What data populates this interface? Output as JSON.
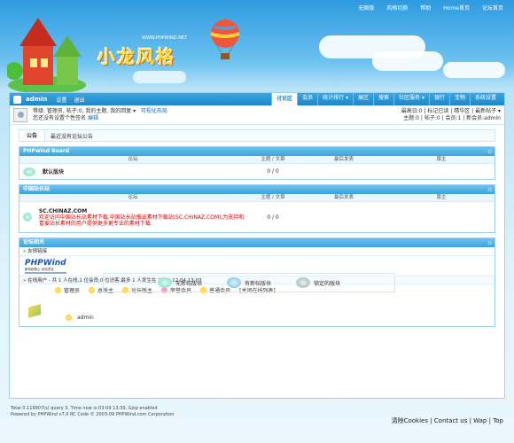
{
  "topnav": [
    "无图版",
    "风格切换",
    "帮助",
    "Home首页",
    "论坛首页"
  ],
  "logo": {
    "text": "小龙风格",
    "url": "WWW.PHPWIND.NET"
  },
  "userbar": {
    "username": "admin",
    "links": [
      "设置",
      "退出"
    ],
    "menu": [
      "讨论区",
      "会员",
      "统计排行 ▾",
      "展区",
      "搜索",
      "社区服务 ▾",
      "银行",
      "宝物",
      "系统设置"
    ]
  },
  "info": {
    "line1": "等级: 管理员, 帖子:0, 我的主题, 我的回复 ▾",
    "line1b": "可视化布局",
    "line2": "您还没有设置个性签名",
    "line2b": "编辑",
    "right1": "最高日:0 | 标记已读 | 精华区 | 最新帖子 ▾",
    "right2": "主题:0 | 帖子:0 | 会员:1 | 新会员:admin"
  },
  "notice": {
    "label": "公告",
    "text": "最近没有论坛公告"
  },
  "columns": {
    "forum": "论坛",
    "topics": "主题 / 文章",
    "lastpost": "最后发表",
    "moderator": "版主"
  },
  "sections": [
    {
      "title": "PHPwind Board",
      "forum_name": "默认版块",
      "counts": "0 / 0"
    },
    {
      "title": "中国站长站",
      "counts": "0 / 0",
      "chinaz_title": "SC.CHINAZ.COM",
      "chinaz_text": "欢迎访问中国站长站素材下载,中国站长站推出素材下载站(SC.CHINAZ.COM),为支持和喜爱站长素材的用户提供更多更专业的素材下载."
    }
  ],
  "stats": {
    "title": "论坛相关",
    "links_label": "友情链接",
    "pw_logo": "PHPWind",
    "pw_sub": "新世纪网上 论坛发言",
    "online": "在线用户 - 共 1 人在线,1 位会员,0 位访客,最多 1 人发生在 2008-12-04 13:03",
    "legend": [
      "管理员",
      "总版主",
      "论坛版主",
      "荣誉会员",
      "普通会员",
      "[关闭在线列表]"
    ],
    "online_user": "admin"
  },
  "legend_box": [
    "无新帖版块",
    "有新帖版块",
    "锁定的版块"
  ],
  "footer": {
    "line1": "Total 0.119907(s) query 3, Time now is:03-09 13:30, Gzip enabled",
    "line2": "Powered by PHPWind v7.0 RC Code © 2003-09 PHPWind.com Corporation",
    "right": [
      "清除Cookies",
      "Contact us",
      "Wap",
      "Top"
    ]
  }
}
